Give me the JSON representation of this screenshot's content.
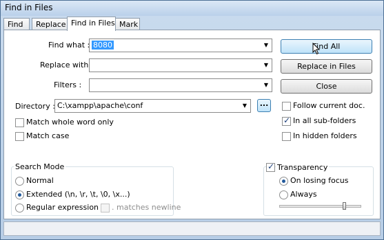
{
  "window": {
    "title": "Find in Files"
  },
  "tabs": [
    {
      "label": "Find",
      "active": false
    },
    {
      "label": "Replace",
      "active": false
    },
    {
      "label": "Find in Files",
      "active": true
    },
    {
      "label": "Mark",
      "active": false
    }
  ],
  "fields": {
    "find_what": {
      "label": "Find what :",
      "value": "8080"
    },
    "replace_with": {
      "label": "Replace with :",
      "value": ""
    },
    "filters": {
      "label": "Filters :",
      "value": ""
    },
    "directory": {
      "label": "Directory :",
      "value": "C:\\xampp\\apache\\conf",
      "browse_label": "..."
    }
  },
  "buttons": {
    "find_all": "Find All",
    "replace_in_files": "Replace in Files",
    "close": "Close"
  },
  "options": {
    "match_whole_word": {
      "label": "Match whole word only",
      "checked": false
    },
    "match_case": {
      "label": "Match case",
      "checked": false
    },
    "follow_current_doc": {
      "label": "Follow current doc.",
      "checked": false
    },
    "in_all_subfolders": {
      "label": "In all sub-folders",
      "checked": true
    },
    "in_hidden_folders": {
      "label": "In hidden folders",
      "checked": false
    }
  },
  "search_mode": {
    "title": "Search Mode",
    "normal": "Normal",
    "extended": "Extended (\\n, \\r, \\t, \\0, \\x...)",
    "regex": "Regular expression",
    "matches_newline": ". matches newline",
    "selected": "extended"
  },
  "transparency": {
    "label": "Transparency",
    "enabled": true,
    "on_losing_focus": "On losing focus",
    "always": "Always",
    "selected": "on_losing_focus",
    "level": 0.8
  }
}
